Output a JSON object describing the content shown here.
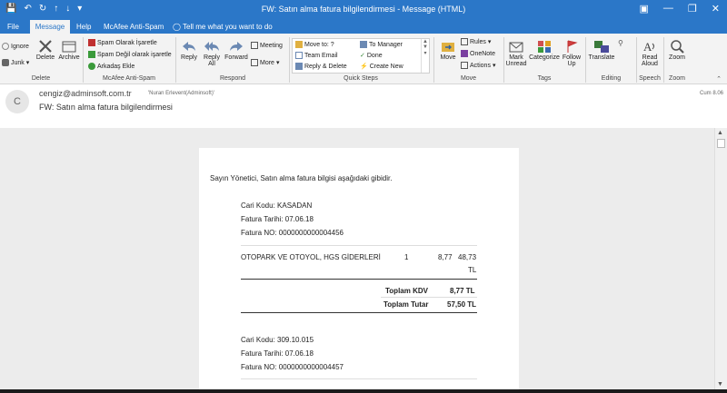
{
  "titlebar": {
    "title": "FW: Satın alma fatura bilgilendirmesi  -  Message (HTML)"
  },
  "tabs": [
    "File",
    "Message",
    "Help",
    "McAfee Anti-Spam"
  ],
  "tell_me": "Tell me what you want to do",
  "ribbon": {
    "delete_group": {
      "ignore": "Ignore",
      "junk": "Junk",
      "delete": "Delete",
      "archive": "Archive",
      "label": "Delete"
    },
    "mcafee_group": {
      "items": [
        "Spam Olarak İşaretle",
        "Spam Değil olarak işaretle",
        "Arkadaş Ekle"
      ],
      "label": "McAfee Anti-Spam"
    },
    "respond_group": {
      "reply": "Reply",
      "reply_all": "Reply All",
      "forward": "Forward",
      "meeting": "Meeting",
      "more": "More",
      "label": "Respond"
    },
    "quicksteps_group": {
      "items": [
        "Move to: ?",
        "To Manager",
        "Team Email",
        "Done",
        "Reply & Delete",
        "Create New"
      ],
      "label": "Quick Steps"
    },
    "move_group": {
      "move": "Move",
      "rules": "Rules",
      "onenote": "OneNote",
      "actions": "Actions",
      "label": "Move"
    },
    "tags_group": {
      "mark_unread": "Mark Unread",
      "categorize": "Categorize",
      "follow_up": "Follow Up",
      "label": "Tags"
    },
    "editing_group": {
      "translate": "Translate",
      "label": "Editing"
    },
    "speech_group": {
      "read_aloud": "Read Aloud",
      "label": "Speech"
    },
    "zoom_group": {
      "zoom": "Zoom",
      "label": "Zoom"
    }
  },
  "message": {
    "avatar_letter": "C",
    "from": "cengiz@adminsoft.com.tr",
    "to": "'Nuran Erlevent(Adminsoft)'",
    "date": "Cum 8.06",
    "subject": "FW: Satın alma fatura bilgilendirmesi"
  },
  "body": {
    "greeting": "Sayın Yönetici, Satın alma fatura bilgisi aşağıdaki gibidir.",
    "invoice1": {
      "cari_kodu": "Cari Kodu: KASADAN",
      "fatura_tarihi": "Fatura Tarihi: 07.06.18",
      "fatura_no": "Fatura NO: 0000000000004456",
      "line": {
        "desc": "OTOPARK VE OTOYOL, HGS GİDERLERİ",
        "qty": "1",
        "price": "8,77",
        "total": "48,73",
        "currency": "TL"
      },
      "kdv_label": "Toplam KDV",
      "kdv_value": "8,77 TL",
      "tutar_label": "Toplam Tutar",
      "tutar_value": "57,50 TL"
    },
    "invoice2": {
      "cari_kodu": "Cari Kodu: 309.10.015",
      "fatura_tarihi": "Fatura Tarihi: 07.06.18",
      "fatura_no": "Fatura NO: 0000000000004457"
    }
  },
  "colors": {
    "accent": "#2b77c8"
  }
}
